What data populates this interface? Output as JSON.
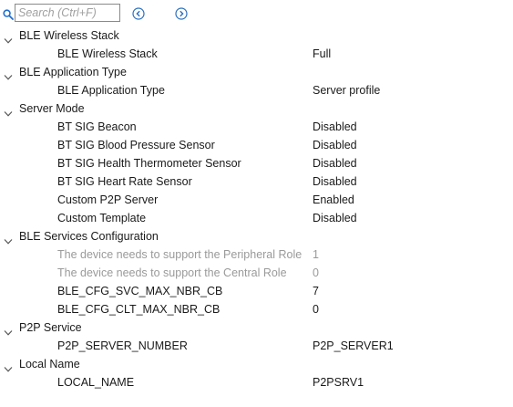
{
  "search": {
    "placeholder": "Search (Ctrl+F)",
    "value": ""
  },
  "icons": {
    "search": "search-icon",
    "previous": "chevron-left-circle-icon",
    "next": "chevron-right-circle-icon",
    "expand": "chevron-down-icon"
  },
  "colors": {
    "nav_icon": "#2a6fbf",
    "search_icon": "#1f6fd1",
    "disabled_text": "#9a9a9a"
  },
  "groups": [
    {
      "label": "BLE Wireless Stack",
      "expanded": true,
      "params": [
        {
          "name": "BLE Wireless Stack",
          "value": "Full",
          "enabled": true
        }
      ]
    },
    {
      "label": "BLE Application Type",
      "expanded": true,
      "params": [
        {
          "name": "BLE Application Type",
          "value": "Server profile",
          "enabled": true
        }
      ]
    },
    {
      "label": "Server Mode",
      "expanded": true,
      "params": [
        {
          "name": "BT SIG Beacon",
          "value": "Disabled",
          "enabled": true
        },
        {
          "name": "BT SIG Blood Pressure Sensor",
          "value": "Disabled",
          "enabled": true
        },
        {
          "name": "BT SIG Health Thermometer Sensor",
          "value": "Disabled",
          "enabled": true
        },
        {
          "name": "BT SIG Heart Rate Sensor",
          "value": "Disabled",
          "enabled": true
        },
        {
          "name": "Custom P2P Server",
          "value": "Enabled",
          "enabled": true
        },
        {
          "name": "Custom Template",
          "value": "Disabled",
          "enabled": true
        }
      ]
    },
    {
      "label": "BLE Services Configuration",
      "expanded": true,
      "params": [
        {
          "name": "The device needs to support the Peripheral Role",
          "value": "1",
          "enabled": false
        },
        {
          "name": "The device needs to support the Central Role",
          "value": "0",
          "enabled": false
        },
        {
          "name": "BLE_CFG_SVC_MAX_NBR_CB",
          "value": "7",
          "enabled": true
        },
        {
          "name": "BLE_CFG_CLT_MAX_NBR_CB",
          "value": "0",
          "enabled": true
        }
      ]
    },
    {
      "label": "P2P Service",
      "expanded": true,
      "params": [
        {
          "name": "P2P_SERVER_NUMBER",
          "value": "P2P_SERVER1",
          "enabled": true
        }
      ]
    },
    {
      "label": "Local Name",
      "expanded": true,
      "params": [
        {
          "name": "LOCAL_NAME",
          "value": "P2PSRV1",
          "enabled": true
        }
      ]
    }
  ]
}
